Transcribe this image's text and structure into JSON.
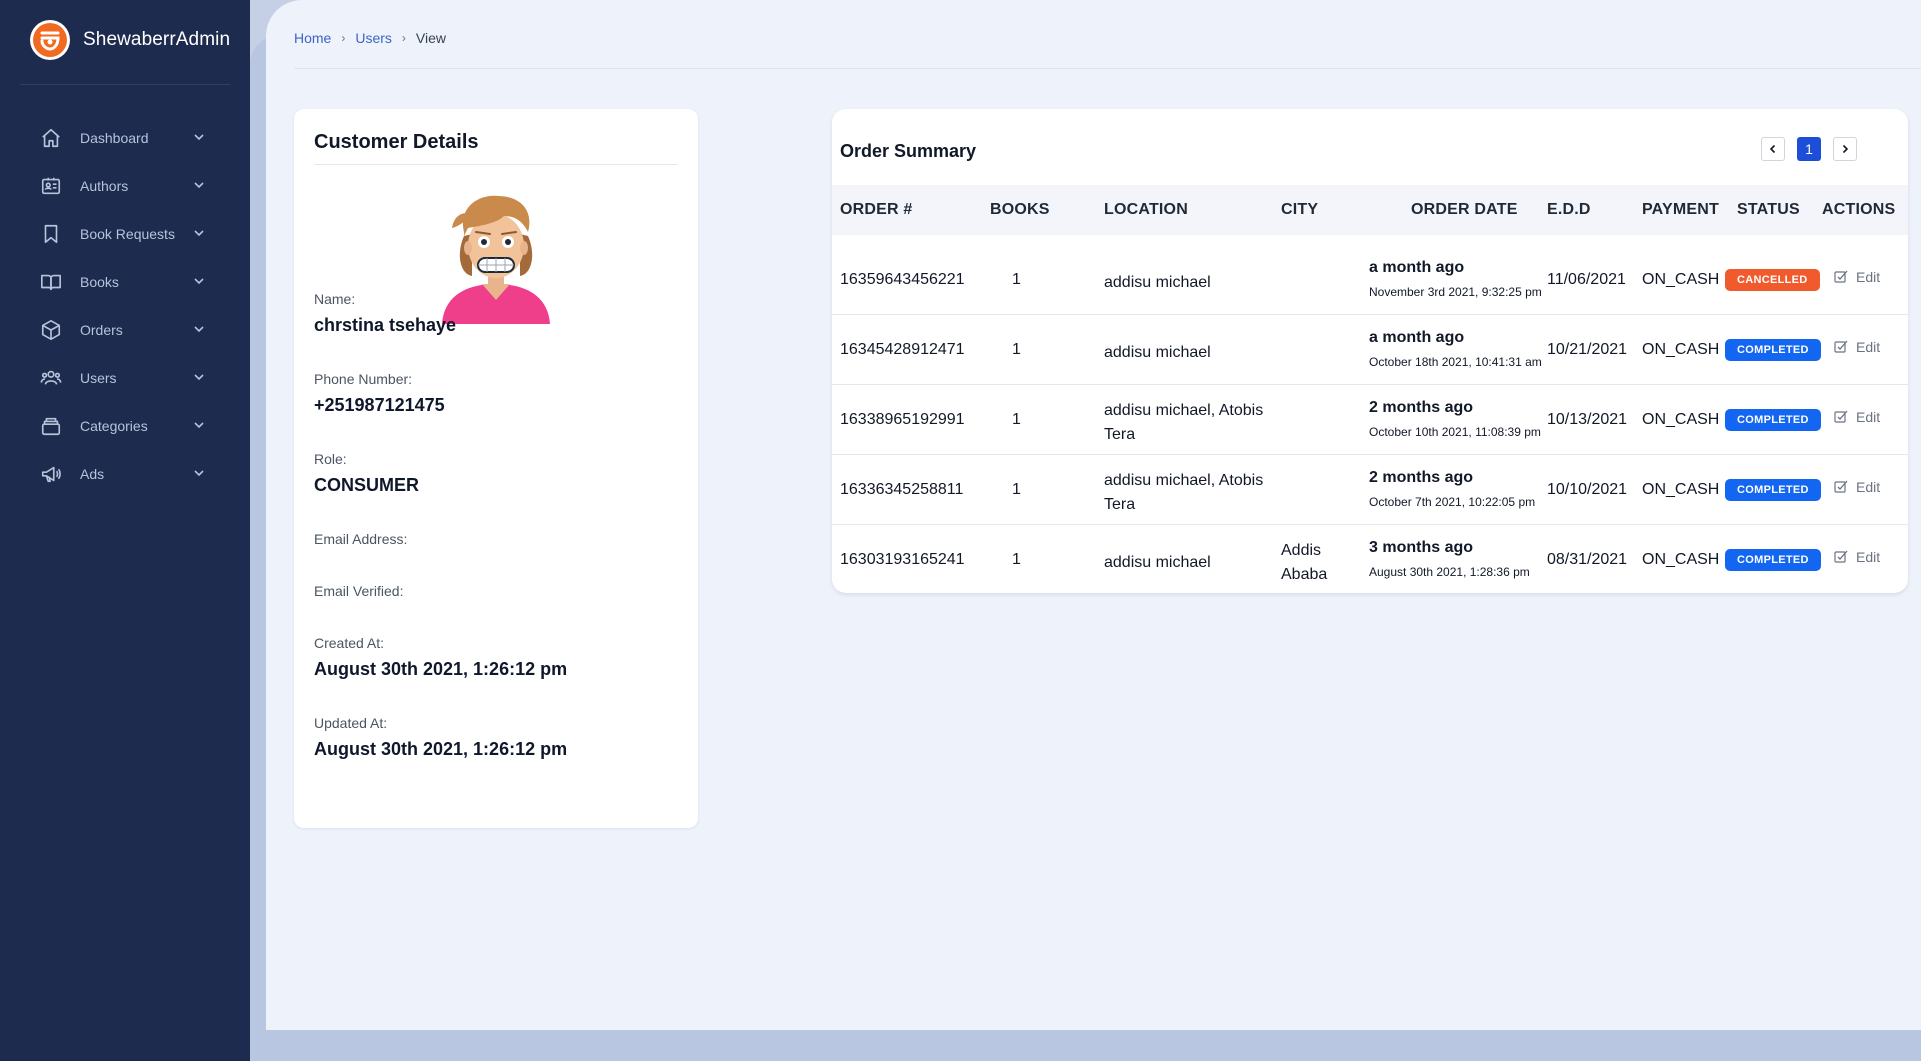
{
  "brand": {
    "name": "ShewaberrAdmin"
  },
  "sidebar": {
    "items": [
      {
        "label": "Dashboard",
        "icon": "home-icon"
      },
      {
        "label": "Authors",
        "icon": "id-card-icon"
      },
      {
        "label": "Book Requests",
        "icon": "bookmark-icon"
      },
      {
        "label": "Books",
        "icon": "book-open-icon"
      },
      {
        "label": "Orders",
        "icon": "box-icon"
      },
      {
        "label": "Users",
        "icon": "users-icon"
      },
      {
        "label": "Categories",
        "icon": "archive-icon"
      },
      {
        "label": "Ads",
        "icon": "megaphone-icon"
      }
    ]
  },
  "breadcrumb": {
    "home": "Home",
    "users": "Users",
    "current": "View",
    "separator": "›"
  },
  "customer": {
    "title": "Customer Details",
    "name_label": "Name:",
    "name": "chrstina tsehaye",
    "phone_label": "Phone Number:",
    "phone": "+251987121475",
    "role_label": "Role:",
    "role": "CONSUMER",
    "email_label": "Email Address:",
    "email": "",
    "verified_label": "Email Verified:",
    "verified": "",
    "created_label": "Created At:",
    "created": "August 30th 2021, 1:26:12 pm",
    "updated_label": "Updated At:",
    "updated": "August 30th 2021, 1:26:12 pm"
  },
  "orders": {
    "title": "Order Summary",
    "page": "1",
    "columns": [
      "ORDER #",
      "BOOKS",
      "LOCATION",
      "CITY",
      "ORDER DATE",
      "E.D.D",
      "PAYMENT",
      "STATUS",
      "ACTIONS"
    ],
    "edit_label": "Edit",
    "rows": [
      {
        "order": "16359643456221",
        "books": "1",
        "location": "addisu michael",
        "city": "",
        "date_rel": "a month ago",
        "date_abs": "November 3rd 2021, 9:32:25 pm",
        "edd": "11/06/2021",
        "payment": "ON_CASH",
        "status": "CANCELLED"
      },
      {
        "order": "16345428912471",
        "books": "1",
        "location": "addisu michael",
        "city": "",
        "date_rel": "a month ago",
        "date_abs": "October 18th 2021, 10:41:31 am",
        "edd": "10/21/2021",
        "payment": "ON_CASH",
        "status": "COMPLETED"
      },
      {
        "order": "16338965192991",
        "books": "1",
        "location": "addisu michael, Atobis Tera",
        "city": "",
        "date_rel": "2 months ago",
        "date_abs": "October 10th 2021, 11:08:39 pm",
        "edd": "10/13/2021",
        "payment": "ON_CASH",
        "status": "COMPLETED"
      },
      {
        "order": "16336345258811",
        "books": "1",
        "location": "addisu michael, Atobis Tera",
        "city": "",
        "date_rel": "2 months ago",
        "date_abs": "October 7th 2021, 10:22:05 pm",
        "edd": "10/10/2021",
        "payment": "ON_CASH",
        "status": "COMPLETED"
      },
      {
        "order": "16303193165241",
        "books": "1",
        "location": "addisu michael",
        "city": "Addis Ababa",
        "date_rel": "3 months ago",
        "date_abs": "August 30th 2021, 1:28:36 pm",
        "edd": "08/31/2021",
        "payment": "ON_CASH",
        "status": "COMPLETED"
      }
    ]
  },
  "colors": {
    "sidebar_bg": "#1c2b4e",
    "accent": "#1d4ed8",
    "cancelled": "#f15a2c",
    "completed": "#1266f1"
  }
}
